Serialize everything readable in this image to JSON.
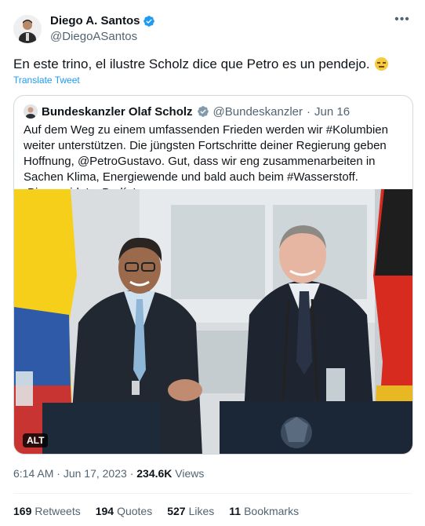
{
  "author": {
    "name": "Diego A. Santos",
    "handle": "@DiegoASantos"
  },
  "tweet": {
    "text": "En este trino, el ilustre Scholz dice que Petro es un pendejo.",
    "translate": "Translate Tweet"
  },
  "quote": {
    "name": "Bundeskanzler Olaf Scholz",
    "handle": "@Bundeskanzler",
    "dot": "·",
    "date": "Jun 16",
    "text": "Auf dem Weg zu einem umfassenden Frieden werden wir #Kolumbien weiter unterstützen. Die jüngsten Fortschritte deiner Regierung geben Hoffnung, @PetroGustavo. Gut, dass wir eng zusammenarbeiten in Sachen Klima, Energiewende und bald auch beim #Wasserstoff. ¡Bienvenido! a Berlín!",
    "alt_label": "ALT"
  },
  "meta": {
    "time": "6:14 AM",
    "dot": "·",
    "date": "Jun 17, 2023",
    "views_count": "234.6K",
    "views_label": "Views"
  },
  "stats": [
    {
      "count": "169",
      "label": "Retweets"
    },
    {
      "count": "194",
      "label": "Quotes"
    },
    {
      "count": "527",
      "label": "Likes"
    },
    {
      "count": "11",
      "label": "Bookmarks"
    }
  ],
  "colors": {
    "link": "#1d9bf0",
    "verified_gold": "#e2b719",
    "secondary_text": "#536471"
  }
}
